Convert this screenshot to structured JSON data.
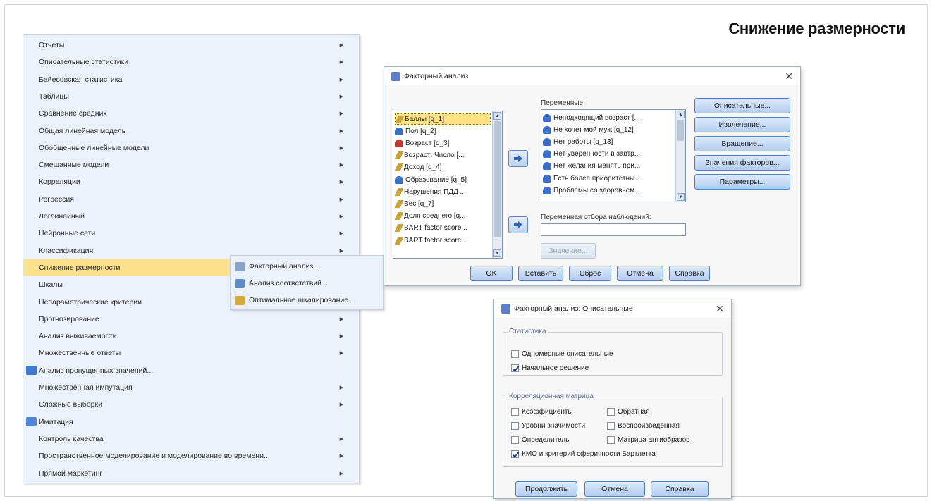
{
  "slide": {
    "title": "Снижение размерности"
  },
  "menu": {
    "items": [
      {
        "label": "Отчеты",
        "arrow": true
      },
      {
        "label": "Описательные статистики",
        "arrow": true
      },
      {
        "label": "Байесовская статистика",
        "arrow": true
      },
      {
        "label": "Таблицы",
        "arrow": true
      },
      {
        "label": "Сравнение средних",
        "arrow": true
      },
      {
        "label": "Общая линейная модель",
        "arrow": true
      },
      {
        "label": "Обобщенные линейные модели",
        "arrow": true
      },
      {
        "label": "Смешанные модели",
        "arrow": true
      },
      {
        "label": "Корреляции",
        "arrow": true
      },
      {
        "label": "Регрессия",
        "arrow": true
      },
      {
        "label": "Логлинейный",
        "arrow": true
      },
      {
        "label": "Нейронные сети",
        "arrow": true
      },
      {
        "label": "Классификация",
        "arrow": true
      },
      {
        "label": "Снижение размерности",
        "arrow": true,
        "highlight": true
      },
      {
        "label": "Шкалы",
        "arrow": true
      },
      {
        "label": "Непараметрические критерии",
        "arrow": true
      },
      {
        "label": "Прогнозирование",
        "arrow": true
      },
      {
        "label": "Анализ выживаемости",
        "arrow": true
      },
      {
        "label": "Множественные ответы",
        "arrow": true
      },
      {
        "label": "Анализ пропущенных значений...",
        "arrow": false,
        "icon": "missing-values-icon"
      },
      {
        "label": "Множественная импутация",
        "arrow": true
      },
      {
        "label": "Сложные выборки",
        "arrow": true
      },
      {
        "label": "Имитация",
        "arrow": false,
        "icon": "simulation-icon"
      },
      {
        "label": "Контроль качества",
        "arrow": true
      },
      {
        "label": "Пространственное моделирование и моделирование во времени...",
        "arrow": true
      },
      {
        "label": "Прямой маркетинг",
        "arrow": true
      }
    ]
  },
  "submenu": {
    "items": [
      {
        "label": "Факторный анализ...",
        "icon": "factor-analysis-icon"
      },
      {
        "label": "Анализ соответствий...",
        "icon": "correspondence-analysis-icon"
      },
      {
        "label": "Оптимальное шкалирование...",
        "icon": "optimal-scaling-icon"
      }
    ]
  },
  "factor_dialog": {
    "title": "Факторный анализ",
    "source_vars": [
      {
        "label": "Баллы [q_1]",
        "icon": "scale-var-icon",
        "selected": true
      },
      {
        "label": "Пол [q_2]",
        "icon": "nominal-var-icon"
      },
      {
        "label": "Возраст [q_3]",
        "icon": "ordinal-var-icon"
      },
      {
        "label": "Возраст: Число [...",
        "icon": "scale-var-icon"
      },
      {
        "label": "Доход [q_4]",
        "icon": "scale-var-icon"
      },
      {
        "label": "Образование [q_5]",
        "icon": "nominal-var-icon"
      },
      {
        "label": "Нарушения ПДД ...",
        "icon": "scale-var-icon"
      },
      {
        "label": "Вес [q_7]",
        "icon": "scale-var-icon"
      },
      {
        "label": "Доля среднего [q...",
        "icon": "scale-var-icon"
      },
      {
        "label": "BART factor score...",
        "icon": "scale-var-icon"
      },
      {
        "label": "BART factor score...",
        "icon": "scale-var-icon"
      }
    ],
    "variables_label": "Переменные:",
    "target_vars": [
      {
        "label": "Неподходящий возраст [...",
        "icon": "nominal-var-icon"
      },
      {
        "label": "Не хочет мой муж [q_12]",
        "icon": "nominal-var-icon"
      },
      {
        "label": "Нет работы [q_13]",
        "icon": "nominal-var-icon"
      },
      {
        "label": "Нет уверенности в завтр...",
        "icon": "nominal-var-icon"
      },
      {
        "label": "Нет желания менять при...",
        "icon": "nominal-var-icon"
      },
      {
        "label": "Есть более приоритетны...",
        "icon": "nominal-var-icon"
      },
      {
        "label": "Проблемы со здоровьем...",
        "icon": "nominal-var-icon"
      }
    ],
    "selection_label": "Переменная отбора наблюдений:",
    "selection_value": "",
    "value_button": "Значение...",
    "side_buttons": [
      "Описательные...",
      "Извлечение...",
      "Вращение...",
      "Значения факторов...",
      "Параметры..."
    ],
    "bottom_buttons": [
      "OK",
      "Вставить",
      "Сброс",
      "Отмена",
      "Справка"
    ]
  },
  "desc_dialog": {
    "title": "Факторный анализ: Описательные",
    "stats_group": "Статистика",
    "stats_options": [
      {
        "label": "Одномерные описательные",
        "checked": false
      },
      {
        "label": "Начальное решение",
        "checked": true
      }
    ],
    "corr_group": "Корреляционная матрица",
    "corr_options": [
      {
        "label": "Коэффициенты",
        "checked": false
      },
      {
        "label": "Обратная",
        "checked": false
      },
      {
        "label": "Уровни значимости",
        "checked": false
      },
      {
        "label": "Воспроизведенная",
        "checked": false
      },
      {
        "label": "Определитель",
        "checked": false
      },
      {
        "label": "Матрица антиобразов",
        "checked": false
      },
      {
        "label": "КМО и критерий сферичности Бартлетта",
        "checked": true
      }
    ],
    "buttons": [
      "Продолжить",
      "Отмена",
      "Справка"
    ]
  },
  "colors": {
    "menu_bg": "#ecf2fb",
    "highlight": "#fbe08d",
    "button_border": "#4d7fc2",
    "nominal_icon": "#3a6fc4",
    "ordinal_icon": "#c0392b",
    "scale_icon": "#c7a43a"
  }
}
